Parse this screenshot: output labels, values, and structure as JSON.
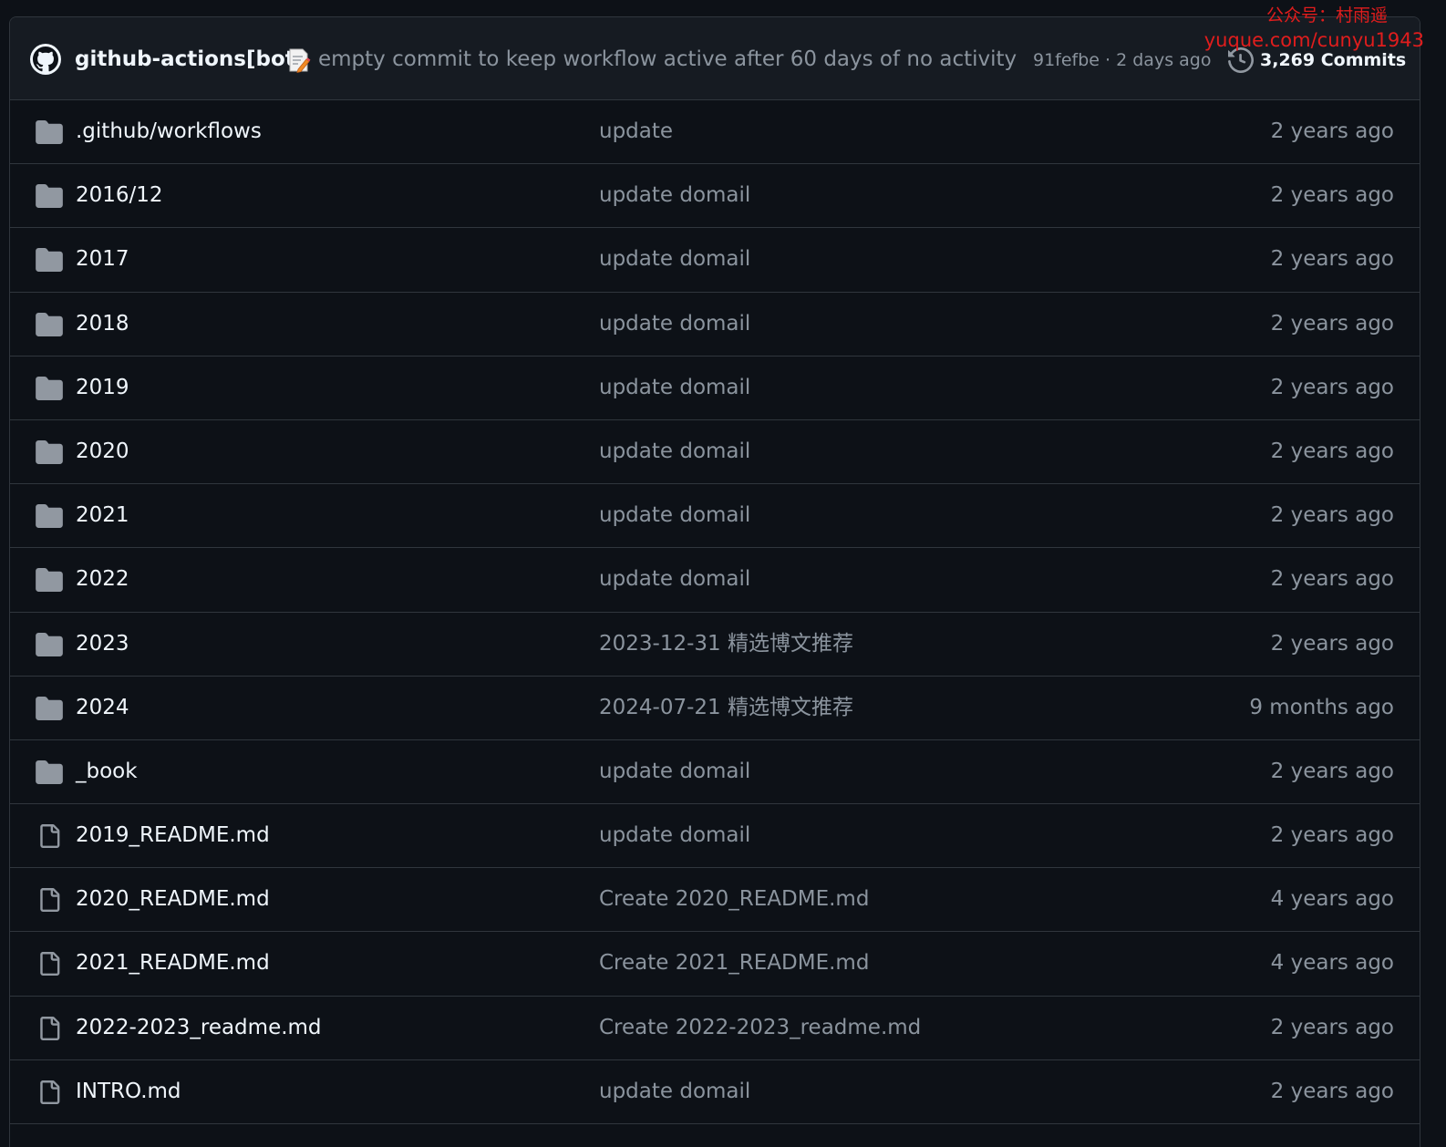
{
  "commit": {
    "author": "github-actions[bot]",
    "message": "empty commit to keep workflow active after 60 days of no activity",
    "meta": "91fefbe · 2 days ago",
    "commits_count": "3,269 Commits",
    "author_avatar_icon": "github-mark-icon",
    "message_icon": "memo-emoji-icon",
    "history_icon": "history-icon"
  },
  "watermark": {
    "line1": "公众号：村雨遥",
    "line2": "yuque.com/cunyu1943"
  },
  "files": [
    {
      "type": "folder",
      "name": ".github/workflows",
      "message": "update",
      "age": "2 years ago"
    },
    {
      "type": "folder",
      "name": "2016/12",
      "message": "update domail",
      "age": "2 years ago"
    },
    {
      "type": "folder",
      "name": "2017",
      "message": "update domail",
      "age": "2 years ago"
    },
    {
      "type": "folder",
      "name": "2018",
      "message": "update domail",
      "age": "2 years ago"
    },
    {
      "type": "folder",
      "name": "2019",
      "message": "update domail",
      "age": "2 years ago"
    },
    {
      "type": "folder",
      "name": "2020",
      "message": "update domail",
      "age": "2 years ago"
    },
    {
      "type": "folder",
      "name": "2021",
      "message": "update domail",
      "age": "2 years ago"
    },
    {
      "type": "folder",
      "name": "2022",
      "message": "update domail",
      "age": "2 years ago"
    },
    {
      "type": "folder",
      "name": "2023",
      "message": "2023-12-31 精选博文推荐",
      "age": "2 years ago"
    },
    {
      "type": "folder",
      "name": "2024",
      "message": "2024-07-21 精选博文推荐",
      "age": "9 months ago"
    },
    {
      "type": "folder",
      "name": "_book",
      "message": "update domail",
      "age": "2 years ago"
    },
    {
      "type": "file",
      "name": "2019_README.md",
      "message": "update domail",
      "age": "2 years ago"
    },
    {
      "type": "file",
      "name": "2020_README.md",
      "message": "Create 2020_README.md",
      "age": "4 years ago"
    },
    {
      "type": "file",
      "name": "2021_README.md",
      "message": "Create 2021_README.md",
      "age": "4 years ago"
    },
    {
      "type": "file",
      "name": "2022-2023_readme.md",
      "message": "Create 2022-2023_readme.md",
      "age": "2 years ago"
    },
    {
      "type": "file",
      "name": "INTRO.md",
      "message": "update domail",
      "age": "2 years ago"
    }
  ],
  "colors": {
    "background": "#0d1117",
    "header": "#161b22",
    "border": "#30363d",
    "text_primary": "#f0f6fc",
    "text_muted": "#8b949e",
    "icon": "#9198a1",
    "watermark": "#e11d1d"
  }
}
